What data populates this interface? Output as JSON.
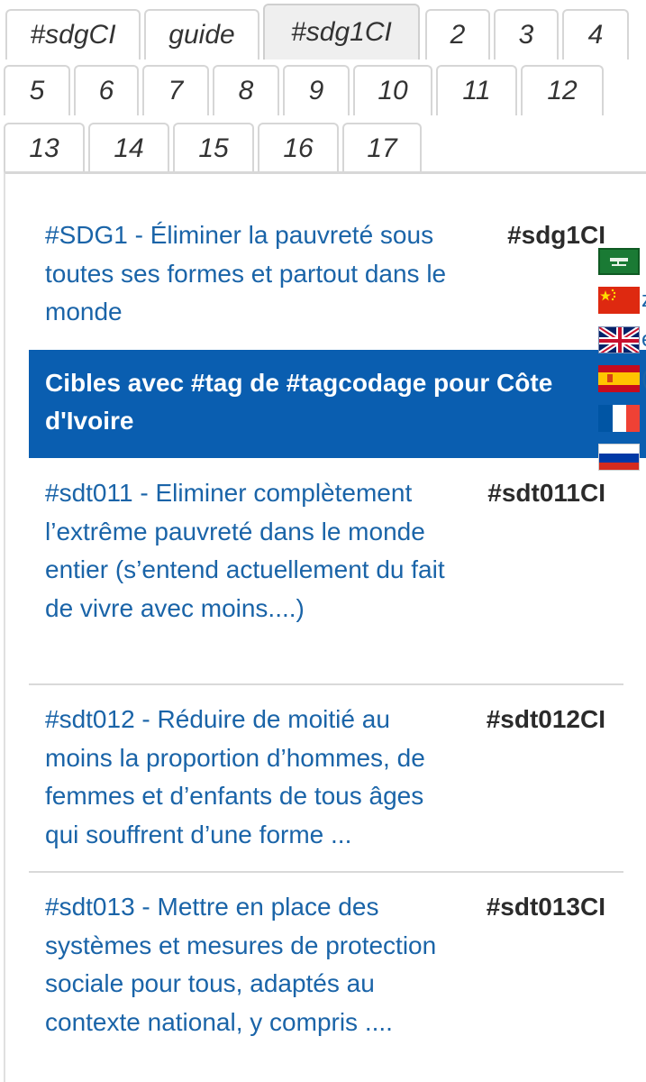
{
  "tabs": [
    {
      "label": "#sdgCI",
      "active": false
    },
    {
      "label": "guide",
      "active": false
    },
    {
      "label": "#sdg1CI",
      "active": true
    },
    {
      "label": "2"
    },
    {
      "label": "3"
    },
    {
      "label": "4"
    },
    {
      "label": "5"
    },
    {
      "label": "6"
    },
    {
      "label": "7"
    },
    {
      "label": "8"
    },
    {
      "label": "9"
    },
    {
      "label": "10"
    },
    {
      "label": "11"
    },
    {
      "label": "12"
    },
    {
      "label": "13"
    },
    {
      "label": "14"
    },
    {
      "label": "15"
    },
    {
      "label": "16"
    },
    {
      "label": "17"
    }
  ],
  "header": {
    "goal_title": "#SDG1 - Éliminer la pauvreté sous toutes ses formes et partout dans le monde",
    "goal_tag": "#sdg1CI"
  },
  "banner": {
    "text": "Cibles avec #tag de #tagcodage pour Côte d'Ivoire"
  },
  "targets": [
    {
      "title": "#sdt011 - Eliminer complètement l’extrême pauvreté dans le monde entier (s’entend actuellement du fait de vivre avec moins....)",
      "tag": "#sdt011CI"
    },
    {
      "title": "#sdt012 - Réduire de moitié au moins la proportion d’hommes, de femmes et d’enfants de tous âges qui souffrent d’une forme ...",
      "tag": "#sdt012CI"
    },
    {
      "title": "#sdt013 - Mettre en place des systèmes et mesures de protection sociale pour tous, adaptés au contexte national, y compris ....",
      "tag": "#sdt013CI"
    }
  ],
  "languages": [
    {
      "icon": "saudi-flag-icon",
      "letter": ""
    },
    {
      "icon": "china-flag-icon",
      "letter": "z"
    },
    {
      "icon": "uk-flag-icon",
      "letter": "e"
    },
    {
      "icon": "spain-flag-icon",
      "letter": "("
    },
    {
      "icon": "france-flag-icon",
      "letter": ""
    },
    {
      "icon": "russia-flag-icon",
      "letter": ""
    }
  ],
  "colors": {
    "link": "#1a64a8",
    "banner": "#0a5eb0",
    "tab_border": "#d6d6d6"
  }
}
